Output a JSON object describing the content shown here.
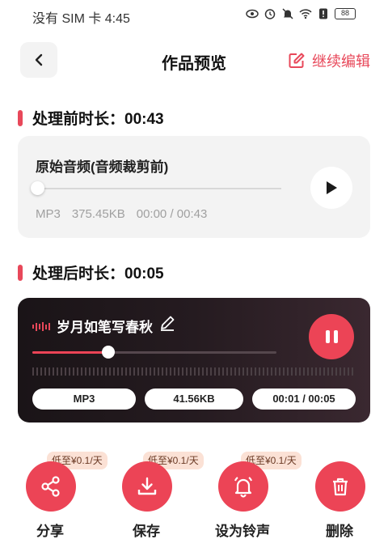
{
  "status": {
    "carrier_time": "没有 SIM 卡 4:45",
    "battery": "88"
  },
  "header": {
    "title": "作品预览",
    "continue_edit": "继续编辑"
  },
  "before": {
    "section_title": "处理前时长：00:43",
    "card_title": "原始音频(音频裁剪前)",
    "format": "MP3",
    "size": "375.45KB",
    "time": "00:00 / 00:43",
    "progress": 0.0
  },
  "after": {
    "section_title": "处理后时长：00:05",
    "card_title": "岁月如笔写春秋",
    "format": "MP3",
    "size": "41.56KB",
    "time": "00:01 / 00:05",
    "progress": 0.31
  },
  "actions": [
    {
      "label": "分享",
      "price": "低至¥0.1/天",
      "icon": "share-icon"
    },
    {
      "label": "保存",
      "price": "低至¥0.1/天",
      "icon": "download-icon"
    },
    {
      "label": "设为铃声",
      "price": "低至¥0.1/天",
      "icon": "bell-icon"
    },
    {
      "label": "删除",
      "price": "",
      "icon": "trash-icon"
    }
  ],
  "colors": {
    "accent": "#ec4456",
    "card_dark": "#1a1417"
  }
}
